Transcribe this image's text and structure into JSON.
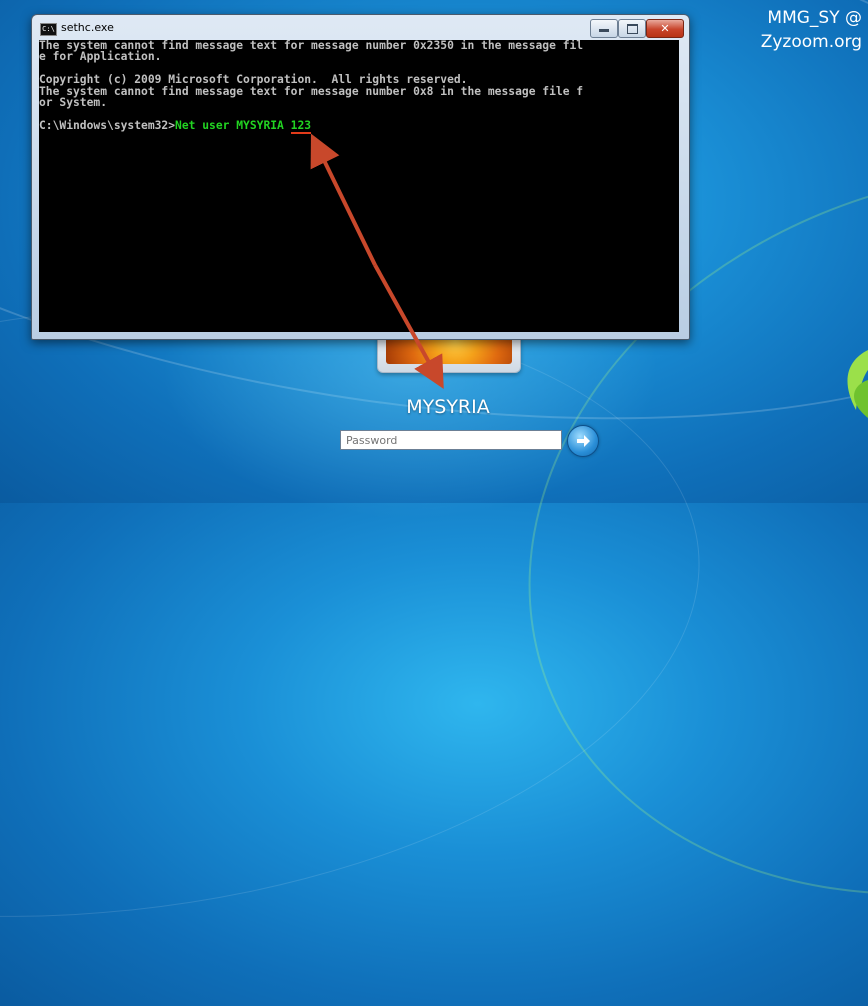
{
  "window": {
    "title": "sethc.exe",
    "icon": "cmd-icon",
    "controls": {
      "minimize": "minimize-icon",
      "maximize": "maximize-icon",
      "close": "✕"
    }
  },
  "console": {
    "lines": [
      "The system cannot find message text for message number 0x2350 in the message fil",
      "e for Application.",
      "",
      "Copyright (c) 2009 Microsoft Corporation.  All rights reserved.",
      "The system cannot find message text for message number 0x8 in the message file f",
      "or System.",
      ""
    ],
    "prompt": "C:\\Windows\\system32>",
    "command": "Net user MYSYRIA ",
    "command_arg": "123"
  },
  "login": {
    "username": "MYSYRIA",
    "password_placeholder": "Password",
    "submit_icon": "arrow-right-icon"
  },
  "watermark": {
    "line1": "MMG_SY @",
    "line2": "Zyzoom.org"
  },
  "colors": {
    "desktop": "#1a8fd6",
    "console_bg": "#000000",
    "console_text": "#c0c0c0",
    "command_text": "#22d422",
    "annotation_arrow": "#c8482b"
  }
}
